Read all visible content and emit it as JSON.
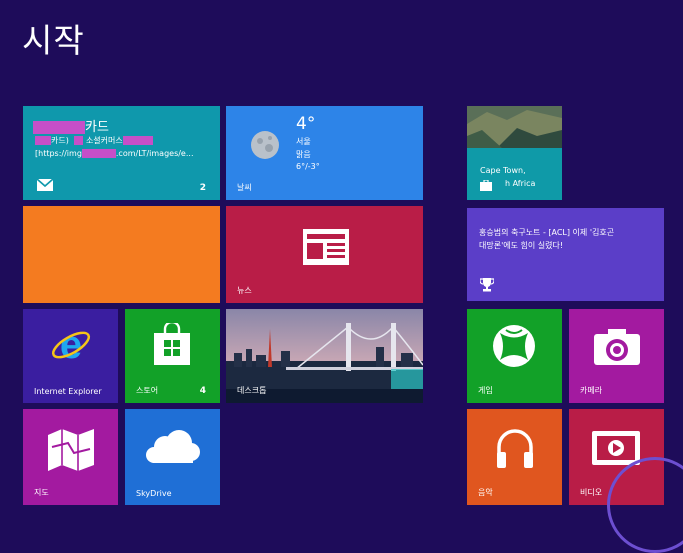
{
  "screen": {
    "title": "시작"
  },
  "colors": {
    "background": "#1e0c5a",
    "mail": "#0f98ac",
    "weather": "#2d84e8",
    "travel": "#0f9aa8",
    "orange": "#f47b20",
    "news": "#b91d47",
    "sports": "#5b3ec8",
    "ie": "#3a1ea0",
    "store": "#12a128",
    "desktop": "#34495e",
    "games": "#12a128",
    "camera": "#a31aa0",
    "maps": "#a31aa0",
    "skydrive": "#1f6fd6",
    "music": "#e0561f",
    "video": "#b91d47"
  },
  "tiles": {
    "mail": {
      "sender_suffix": "카드",
      "line2_part1": "카드)",
      "line2_part2": "소셜커머스",
      "line3_part1": "[https://img",
      "line3_part2": ".com/LT/images/e...",
      "count": "2"
    },
    "weather": {
      "temperature": "4°",
      "city": "서울",
      "condition": "맑음",
      "range": "6°/-3°",
      "label": "날씨"
    },
    "travel": {
      "caption_line1": "Cape Town,",
      "caption_line2": "h Africa"
    },
    "news": {
      "label": "뉴스"
    },
    "sports": {
      "headline_line1": "홍승범의 축구노트 - [ACL] 이제 '김호곤",
      "headline_line2": "대망론'에도 힘이 실렸다!"
    },
    "internet_explorer": {
      "label": "Internet Explorer"
    },
    "store": {
      "label": "스토어",
      "count": "4"
    },
    "desktop": {
      "label": "데스크톱"
    },
    "games": {
      "label": "게임"
    },
    "camera": {
      "label": "카메라"
    },
    "maps": {
      "label": "지도"
    },
    "skydrive": {
      "label": "SkyDrive"
    },
    "music": {
      "label": "음악"
    },
    "video": {
      "label": "비디오"
    }
  }
}
